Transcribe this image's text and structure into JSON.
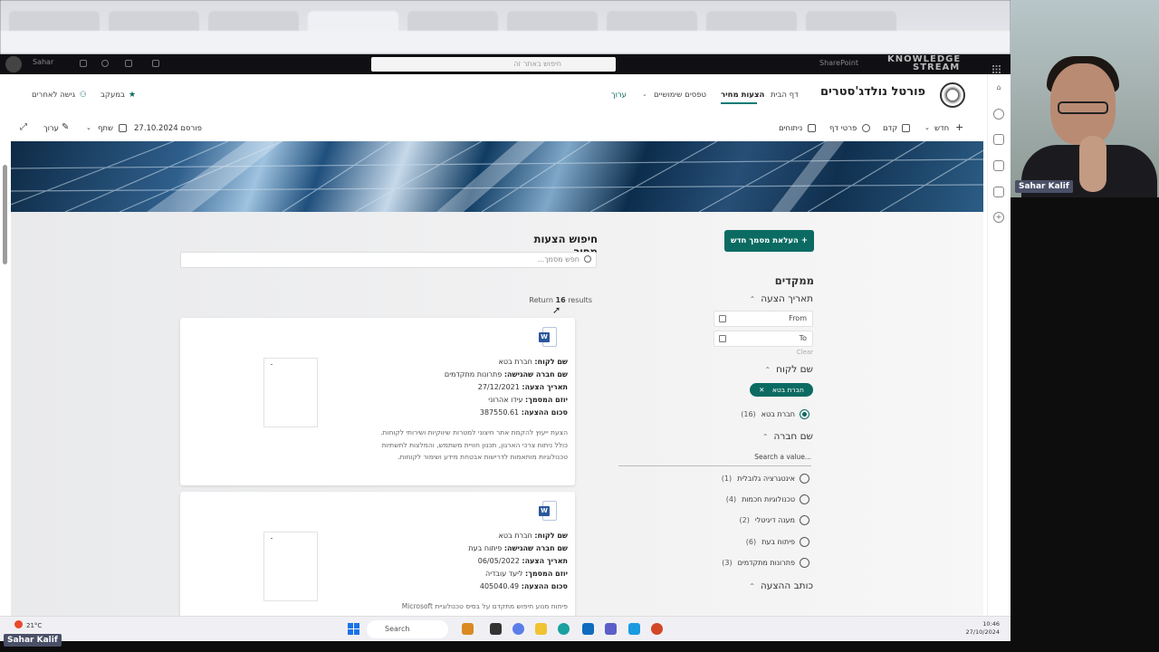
{
  "suite": {
    "app_title": "Sahar",
    "search_placeholder": "חיפוש באתר זה",
    "product": "SharePoint",
    "brand_line1": "KNOWLEDGE",
    "brand_line2": "STREAM"
  },
  "site": {
    "title": "פורטל נולדג'סטרים",
    "nav": [
      {
        "label": "דף הבית"
      },
      {
        "label": "הצעות מחיר"
      },
      {
        "label": "טפסים שימושיים"
      },
      {
        "label": "ערוך"
      }
    ],
    "following": "במעקב",
    "share_access": "גישה לאחרים"
  },
  "command_bar": {
    "new": "חדש",
    "promote": "קדם",
    "page_details": "פרטי דף",
    "analytics": "ניתוחים",
    "published": "פורסם 27.10.2024",
    "share": "שתף",
    "edit": "ערוך"
  },
  "search": {
    "title": "חיפוש הצעות מחיר",
    "placeholder": "חפש מסמך...",
    "results_prefix": "Return",
    "results_count": "16",
    "results_suffix": "results"
  },
  "upload_button": "+ העלאת מסמך חדש",
  "filters": {
    "title": "ממקדים",
    "date_heading": "תאריך הצעה",
    "from_label": "From",
    "to_label": "To",
    "clear_label": "Clear",
    "customer_heading": "שם לקוח",
    "selected_pill": "חברת בטא",
    "customer_options": [
      {
        "label": "חברת בטא",
        "count": "(16)",
        "selected": true
      }
    ],
    "company_heading": "שם חברה",
    "company_search_placeholder": "Search a value...",
    "company_options": [
      {
        "label": "אינטגרציה גלובלית",
        "count": "(1)"
      },
      {
        "label": "טכנולוגיות חכמות",
        "count": "(4)"
      },
      {
        "label": "מענה דיגיטלי",
        "count": "(2)"
      },
      {
        "label": "פיתוח בעת",
        "count": "(6)"
      },
      {
        "label": "פתרונות מתקדמים",
        "count": "(3)"
      }
    ],
    "author_heading": "כותב ההצעה"
  },
  "cards": [
    {
      "file_icon": "word-icon",
      "customer_label": "שם לקוח:",
      "customer": "חברת בטא",
      "company_label": "שם חברה שהגישה:",
      "company": "פתרונות מתקדמים",
      "date_label": "תאריך הצעה:",
      "date": "27/12/2021",
      "initiator_label": "יוזם המסמך:",
      "initiator": "עידו אהרוני",
      "amount_label": "סכום ההצעה:",
      "amount": "387550.61",
      "description": "הצעת ייעוץ להקמת אתר חיצוני למטרות שיווקיות ושירותי לקוחות. כולל ניתוח צרכי הארגון, תכנון חוויית משתמש, והמלצות לתשתיות טכנולוגיות מותאמות לדרישות אבטחת מידע ושימור לקוחות."
    },
    {
      "file_icon": "word-icon",
      "customer_label": "שם לקוח:",
      "customer": "חברת בטא",
      "company_label": "שם חברה שהגישה:",
      "company": "פיתוח בעת",
      "date_label": "תאריך הצעה:",
      "date": "06/05/2022",
      "initiator_label": "יוזם המסמך:",
      "initiator": "ליעד עובדיה",
      "amount_label": "סכום ההצעה:",
      "amount": "405040.49",
      "description": "פיתוח מנוע חיפוש מתקדם על בסיס טכנולוגיית Microsoft"
    }
  ],
  "taskbar": {
    "weather": "21°C",
    "search_label": "Search",
    "time": "10:46",
    "date": "27/10/2024"
  },
  "webcam": {
    "name_top": "Sahar Kalif",
    "name_bottom": "Sahar Kalif"
  },
  "colors": {
    "accent": "#0b6b62",
    "word": "#2b579a"
  }
}
